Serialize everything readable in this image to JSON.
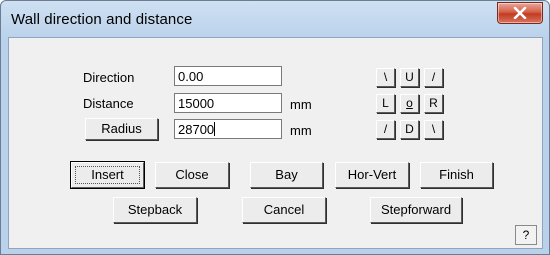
{
  "window": {
    "title": "Wall direction and distance",
    "close_glyph": "X",
    "colors": {
      "title_gradient": "#b9d1ea",
      "close": "#c23b22",
      "client": "#f0f0f0"
    }
  },
  "fields": {
    "direction": {
      "label": "Direction",
      "value": "0.00",
      "unit": ""
    },
    "distance": {
      "label": "Distance",
      "value": "15000",
      "unit": "mm"
    },
    "radius": {
      "label": "Radius",
      "value": "28700",
      "unit": "mm"
    }
  },
  "direction_pad": {
    "row1": [
      "\\",
      "U",
      "/"
    ],
    "row2": [
      "L",
      "o",
      "R"
    ],
    "row3": [
      "/",
      "D",
      "\\"
    ]
  },
  "buttons": {
    "insert": "Insert",
    "close": "Close",
    "bay": "Bay",
    "horvert": "Hor-Vert",
    "finish": "Finish",
    "stepback": "Stepback",
    "cancel": "Cancel",
    "stepforward": "Stepforward",
    "help": "?"
  }
}
